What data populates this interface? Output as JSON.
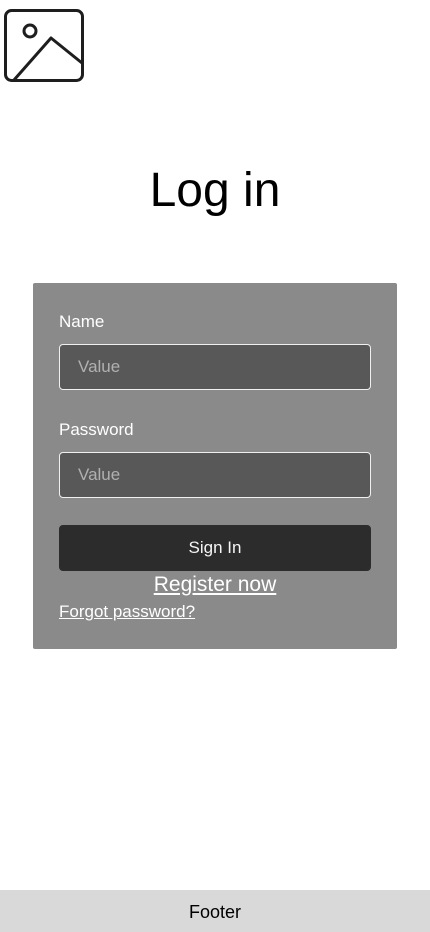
{
  "header": {
    "logo_icon": "image-placeholder-icon",
    "title": "Log in"
  },
  "form": {
    "name_label": "Name",
    "name_placeholder": "Value",
    "password_label": "Password",
    "password_placeholder": "Value",
    "sign_in_label": "Sign In",
    "register_label": "Register now",
    "forgot_label": "Forgot password?"
  },
  "footer": {
    "text": "Footer"
  },
  "colors": {
    "card_background": "#8a8a8a",
    "input_background": "#585858",
    "button_background": "#2c2c2c",
    "footer_background": "#d9d9d9"
  }
}
